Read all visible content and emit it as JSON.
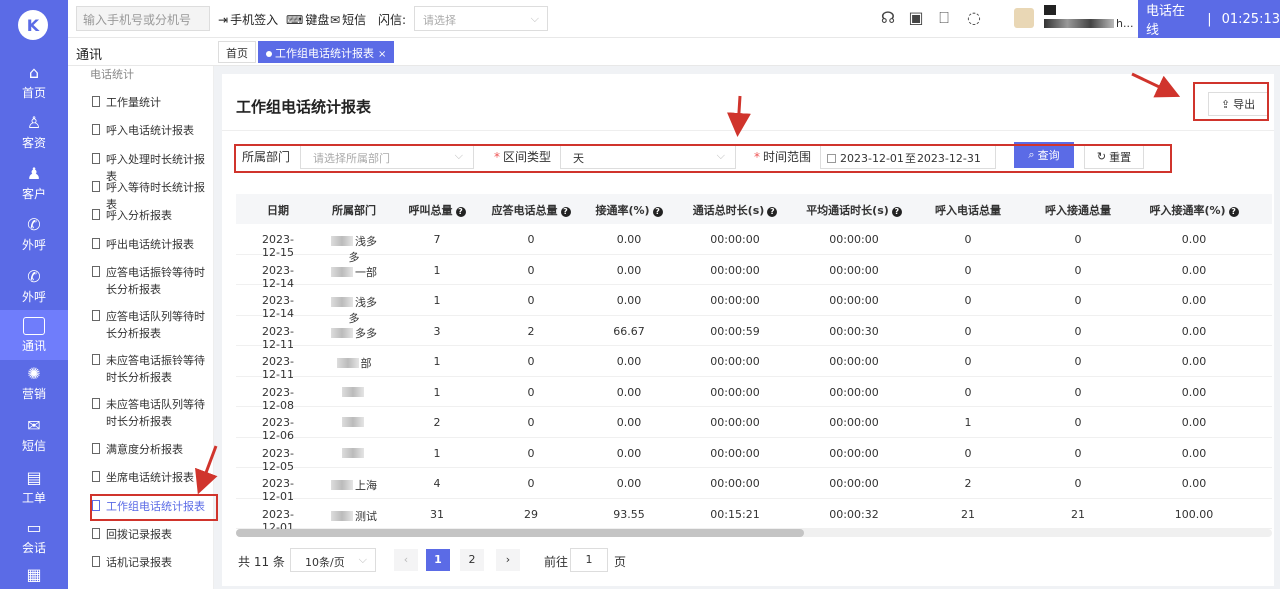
{
  "rail": {
    "logo": "K",
    "items": [
      {
        "label": "首页",
        "icon": "⌂"
      },
      {
        "label": "客资",
        "icon": "♙"
      },
      {
        "label": "客户",
        "icon": "♟"
      },
      {
        "label": "外呼",
        "icon": "✆"
      },
      {
        "label": "外呼",
        "icon": "✆"
      },
      {
        "label": "通讯",
        "icon": ""
      },
      {
        "label": "营销",
        "icon": "✺"
      },
      {
        "label": "短信",
        "icon": "✉"
      },
      {
        "label": "工单",
        "icon": "▤"
      },
      {
        "label": "会话",
        "icon": "▭"
      }
    ]
  },
  "topbar": {
    "phone_placeholder": "输入手机号或分机号",
    "checkin": "手机签入",
    "keypad": "键盘",
    "sms": "短信",
    "flash_label": "闪信:",
    "flash_placeholder": "请选择",
    "username_tail": "h...",
    "status": "电话在线",
    "timer": "01:25:13"
  },
  "crumbbar": {
    "section": "通讯",
    "tab_home": "首页",
    "tab_active": "工作组电话统计报表",
    "tab_close": "×"
  },
  "submenu": {
    "group": "电话统计",
    "items": [
      "工作量统计",
      "呼入电话统计报表",
      "呼入处理时长统计报表",
      "呼入等待时长统计报表",
      "呼入分析报表",
      "呼出电话统计报表",
      "应答电话振铃等待时长分析报表",
      "应答电话队列等待时长分析报表",
      "未应答电话振铃等待时长分析报表",
      "未应答电话队列等待时长分析报表",
      "满意度分析报表",
      "坐席电话统计报表",
      "工作组电话统计报表",
      "回拨记录报表",
      "话机记录报表"
    ]
  },
  "main": {
    "title": "工作组电话统计报表",
    "export_label": "导出",
    "filters": {
      "dept_label": "所属部门",
      "dept_placeholder": "请选择所属部门",
      "interval_label": "区间类型",
      "interval_value": "天",
      "time_label": "时间范围",
      "date_start": "2023-12-01",
      "date_sep": "至",
      "date_end": "2023-12-31",
      "query_label": "查询",
      "reset_label": "重置"
    },
    "table": {
      "headers": [
        "日期",
        "所属部门",
        "呼叫总量",
        "应答电话总量",
        "接通率(%)",
        "通话总时长(s)",
        "平均通话时长(s)",
        "呼入电话总量",
        "呼入接通总量",
        "呼入接通率(%)"
      ],
      "rows": [
        [
          "2023-12-15",
          "浅多多",
          "7",
          "0",
          "0.00",
          "00:00:00",
          "00:00:00",
          "0",
          "0",
          "0.00"
        ],
        [
          "2023-12-14",
          "一部",
          "1",
          "0",
          "0.00",
          "00:00:00",
          "00:00:00",
          "0",
          "0",
          "0.00"
        ],
        [
          "2023-12-14",
          "浅多多",
          "1",
          "0",
          "0.00",
          "00:00:00",
          "00:00:00",
          "0",
          "0",
          "0.00"
        ],
        [
          "2023-12-11",
          "多多",
          "3",
          "2",
          "66.67",
          "00:00:59",
          "00:00:30",
          "0",
          "0",
          "0.00"
        ],
        [
          "2023-12-11",
          "部",
          "1",
          "0",
          "0.00",
          "00:00:00",
          "00:00:00",
          "0",
          "0",
          "0.00"
        ],
        [
          "2023-12-08",
          "",
          "1",
          "0",
          "0.00",
          "00:00:00",
          "00:00:00",
          "0",
          "0",
          "0.00"
        ],
        [
          "2023-12-06",
          "",
          "2",
          "0",
          "0.00",
          "00:00:00",
          "00:00:00",
          "1",
          "0",
          "0.00"
        ],
        [
          "2023-12-05",
          "",
          "1",
          "0",
          "0.00",
          "00:00:00",
          "00:00:00",
          "0",
          "0",
          "0.00"
        ],
        [
          "2023-12-01",
          "上海",
          "4",
          "0",
          "0.00",
          "00:00:00",
          "00:00:00",
          "2",
          "0",
          "0.00"
        ],
        [
          "2023-12-01",
          "测试",
          "31",
          "29",
          "93.55",
          "00:15:21",
          "00:00:32",
          "21",
          "21",
          "100.00"
        ]
      ]
    },
    "pager": {
      "total": "共 11 条",
      "page_size": "10条/页",
      "pages": [
        "1",
        "2"
      ],
      "prev": "‹",
      "next": "›",
      "goto": "前往",
      "goto_value": "1",
      "unit": "页"
    }
  },
  "colors": {
    "accent": "#5b6be6",
    "annotation": "#d0342c"
  }
}
